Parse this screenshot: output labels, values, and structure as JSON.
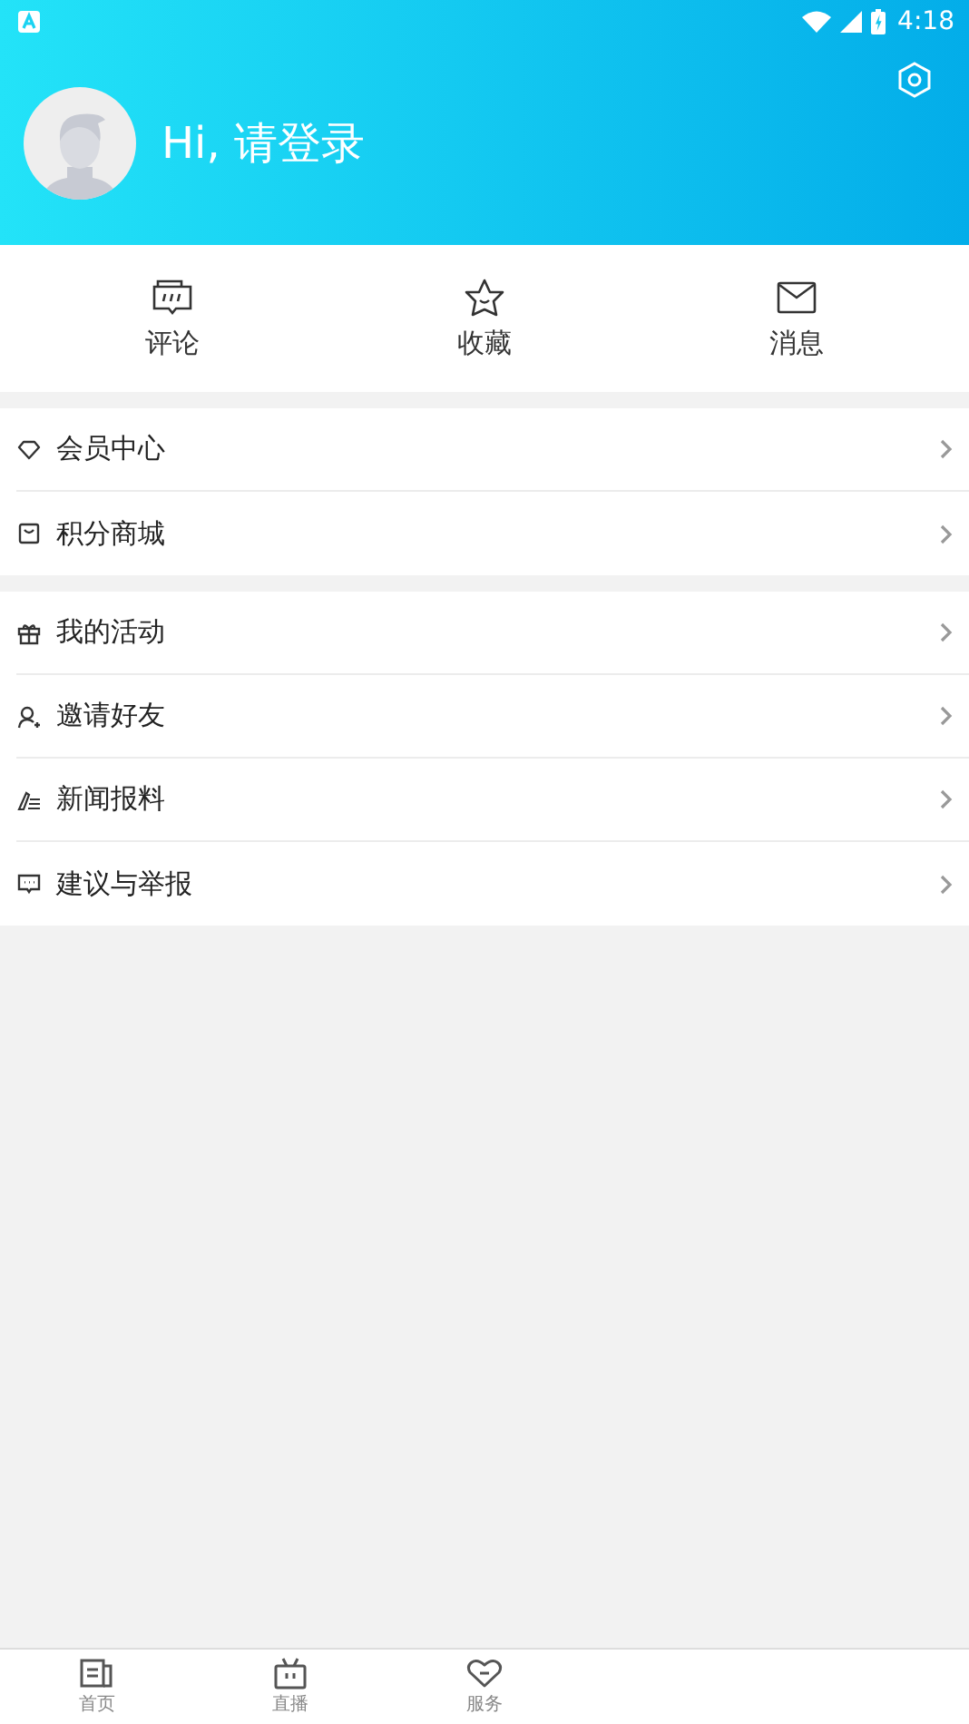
{
  "status_bar": {
    "time": "4:18"
  },
  "header": {
    "greeting": "Hi, 请登录"
  },
  "shortcuts": [
    {
      "kind": "comment",
      "label": "评论"
    },
    {
      "kind": "star",
      "label": "收藏"
    },
    {
      "kind": "mail",
      "label": "消息"
    }
  ],
  "menu_groups": [
    [
      {
        "kind": "diamond",
        "label": "会员中心"
      },
      {
        "kind": "bag",
        "label": "积分商城"
      }
    ],
    [
      {
        "kind": "gift",
        "label": "我的活动"
      },
      {
        "kind": "person",
        "label": "邀请好友"
      },
      {
        "kind": "pen",
        "label": "新闻报料"
      },
      {
        "kind": "chat",
        "label": "建议与举报"
      }
    ]
  ],
  "bottom_tabs": [
    {
      "kind": "news",
      "label": "首页"
    },
    {
      "kind": "tv",
      "label": "直播"
    },
    {
      "kind": "heart",
      "label": "服务"
    }
  ]
}
